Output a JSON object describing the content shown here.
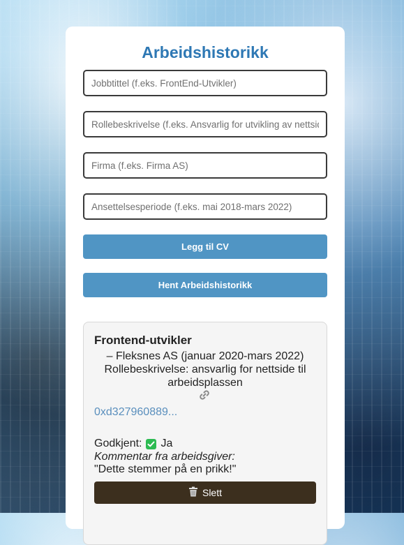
{
  "form": {
    "title": "Arbeidshistorikk",
    "job_title_placeholder": "Jobbtittel (f.eks. FrontEnd-Utvikler)",
    "role_placeholder": "Rollebeskrivelse (f.eks. Ansvarlig for utvikling av nettsid",
    "company_placeholder": "Firma (f.eks. Firma AS)",
    "period_placeholder": "Ansettelsesperiode (f.eks. mai 2018-mars 2022)",
    "add_button": "Legg til CV",
    "fetch_button": "Hent Arbeidshistorikk"
  },
  "entry": {
    "job_title": "Frontend-utvikler",
    "company_line": "– Fleksnes AS (januar 2020-mars 2022)",
    "role_line": "Rollebeskrivelse: ansvarlig for nettside til arbeidsplassen",
    "link_icon": "link-icon",
    "hash": "0xd327960889...",
    "approved_label": "Godkjent:",
    "approved_value": "Ja",
    "comment_label": "Kommentar fra arbeidsgiver:",
    "comment": "\"Dette stemmer på en prikk!\"",
    "delete_button": "Slett"
  },
  "colors": {
    "accent": "#2e78b4",
    "button": "#5095c4",
    "delete": "#3c2f1e",
    "check": "#2dbb52",
    "hash_link": "#5a8fbd"
  }
}
